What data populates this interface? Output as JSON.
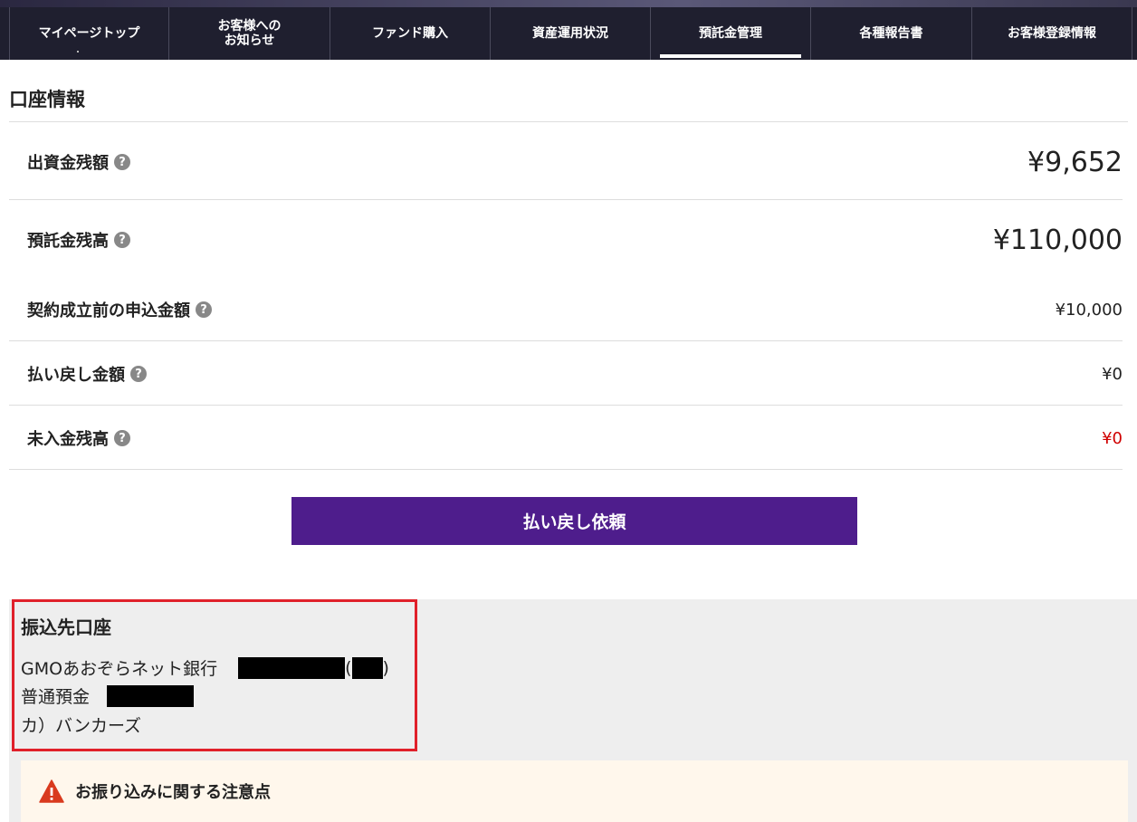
{
  "nav": {
    "items": [
      {
        "label": "マイページトップ",
        "active": false
      },
      {
        "label_line1": "お客様への",
        "label_line2": "お知らせ",
        "active": false
      },
      {
        "label": "ファンド購入",
        "active": false
      },
      {
        "label": "資産運用状況",
        "active": false
      },
      {
        "label": "預託金管理",
        "active": true
      },
      {
        "label": "各種報告書",
        "active": false
      },
      {
        "label": "お客様登録情報",
        "active": false
      }
    ]
  },
  "account": {
    "title": "口座情報",
    "rows": [
      {
        "label": "出資金残額",
        "value": "¥9,652"
      },
      {
        "label": "預託金残高",
        "value": "¥110,000"
      },
      {
        "label": "契約成立前の申込金額",
        "value": "¥10,000"
      },
      {
        "label": "払い戻し金額",
        "value": "¥0"
      },
      {
        "label": "未入金残高",
        "value": "¥0"
      }
    ],
    "help_icon": "?",
    "refund_button": "払い戻し依頼"
  },
  "bank": {
    "title": "振込先口座",
    "bank_name": "GMOあおぞらネット銀行",
    "paren_open": "(",
    "paren_close": ")",
    "account_type": "普通預金",
    "holder": "カ）バンカーズ"
  },
  "notice": {
    "title": "お振り込みに関する注意点"
  },
  "colors": {
    "nav_bg": "#1f1f2f",
    "button_purple": "#4e1d8c",
    "highlight_red": "#e0202a",
    "negative_red": "#d00000"
  }
}
